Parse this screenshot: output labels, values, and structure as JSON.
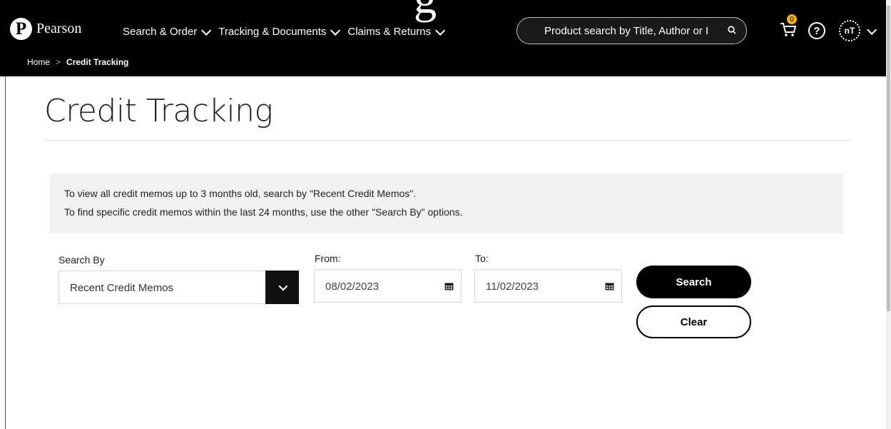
{
  "header": {
    "logo_mark": "P",
    "logo_text": "Pearson",
    "ghost_glyph": "g",
    "nav": [
      {
        "label": "Search & Order"
      },
      {
        "label": "Tracking & Documents"
      },
      {
        "label": "Claims & Returns"
      }
    ],
    "search_placeholder": "Product search by Title, Author or I",
    "cart_count": "0",
    "help_symbol": "?",
    "avatar_initials": "nT"
  },
  "breadcrumb": {
    "home": "Home",
    "separator": ">",
    "current": "Credit Tracking"
  },
  "page": {
    "title": "Credit Tracking",
    "info_line_1": "To view all credit memos up to 3 months old, search by \"Recent Credit Memos\".",
    "info_line_2": "To find specific credit memos within the last 24 months, use the other \"Search By\" options."
  },
  "form": {
    "search_by_label": "Search By",
    "search_by_value": "Recent Credit Memos",
    "from_label": "From:",
    "from_value": "08/02/2023",
    "to_label": "To:",
    "to_value": "11/02/2023",
    "search_button": "Search",
    "clear_button": "Clear"
  },
  "colors": {
    "header_bg": "#000000",
    "badge": "#f3b017",
    "info_panel_bg": "#f2f2f2"
  }
}
